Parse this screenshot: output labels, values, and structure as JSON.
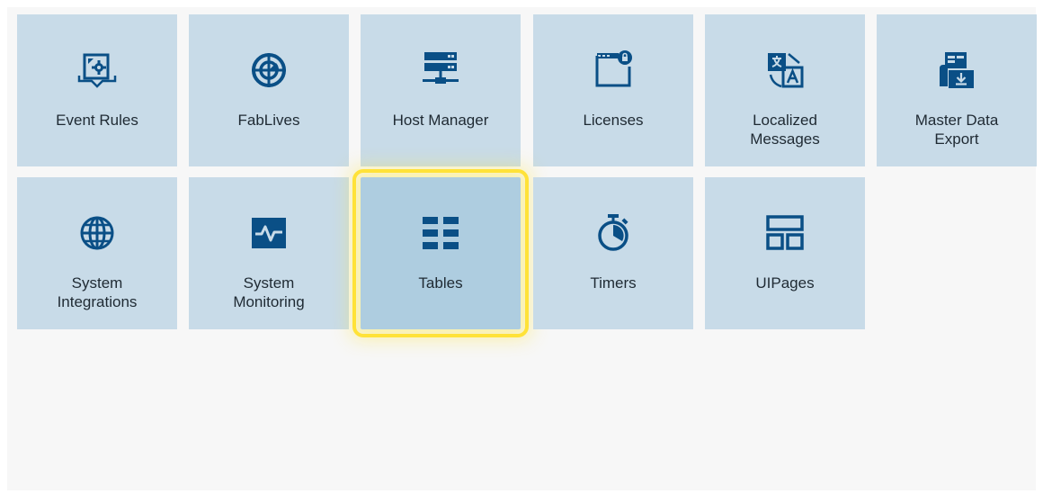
{
  "tiles": [
    {
      "label": "Event Rules",
      "icon": "event-rules-icon"
    },
    {
      "label": "FabLives",
      "icon": "fablives-icon"
    },
    {
      "label": "Host Manager",
      "icon": "host-manager-icon"
    },
    {
      "label": "Licenses",
      "icon": "licenses-icon"
    },
    {
      "label": "Localized\nMessages",
      "icon": "localized-messages-icon"
    },
    {
      "label": "Master Data\nExport",
      "icon": "master-data-export-icon"
    },
    {
      "label": "System\nIntegrations",
      "icon": "globe-icon"
    },
    {
      "label": "System\nMonitoring",
      "icon": "system-monitoring-icon"
    },
    {
      "label": "Tables",
      "icon": "tables-icon"
    },
    {
      "label": "Timers",
      "icon": "timer-icon"
    },
    {
      "label": "UIPages",
      "icon": "uipages-icon"
    }
  ],
  "selected_tile": "Tables",
  "colors": {
    "tile_bg": "#c8dbe8",
    "tile_selected_bg": "#aecde0",
    "icon": "#0a4f86",
    "highlight": "#ffe238",
    "panel_bg": "#f7f7f7"
  }
}
